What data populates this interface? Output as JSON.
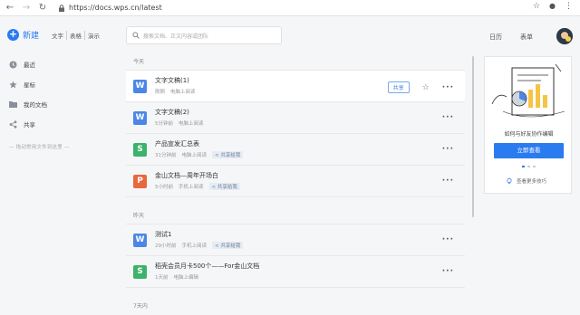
{
  "browser": {
    "url": "https://docs.wps.cn/latest"
  },
  "appbar": {
    "new_label": "新建",
    "new_types": [
      "文字",
      "表格",
      "演示"
    ],
    "search_placeholder": "搜索文档、正文内容或团队",
    "calendar": "日历",
    "forms": "表单"
  },
  "sidebar": {
    "items": [
      {
        "label": "最近",
        "icon": "clock-icon"
      },
      {
        "label": "星标",
        "icon": "star-icon"
      },
      {
        "label": "我的文档",
        "icon": "folder-icon"
      },
      {
        "label": "共享",
        "icon": "share-icon"
      }
    ],
    "hint": "拖动常用文件到这里"
  },
  "sections": [
    {
      "title": "今天",
      "files": [
        {
          "icon": "W",
          "color": "#4a87e6",
          "name": "文字文稿(1)",
          "time": "刚刚",
          "device": "电脑上阅读",
          "shared": ""
        },
        {
          "icon": "W",
          "color": "#4a87e6",
          "name": "文字文稿(2)",
          "time": "5分钟前",
          "device": "电脑上阅读",
          "shared": ""
        },
        {
          "icon": "S",
          "color": "#3bb36a",
          "name": "产品宣发汇总表",
          "time": "31分钟前",
          "device": "电脑上阅读",
          "shared": "共享给我"
        },
        {
          "icon": "P",
          "color": "#e8683e",
          "name": "金山文档—周年开场白",
          "time": "5小时前",
          "device": "手机上阅读",
          "shared": "共享给我"
        }
      ]
    },
    {
      "title": "昨天",
      "files": [
        {
          "icon": "W",
          "color": "#4a87e6",
          "name": "测试1",
          "time": "29小时前",
          "device": "手机上阅读",
          "shared": "共享给我"
        },
        {
          "icon": "S",
          "color": "#3bb36a",
          "name": "稻壳会员月卡500个——For金山文档",
          "time": "1天前",
          "device": "电脑上编辑",
          "shared": ""
        }
      ]
    },
    {
      "title": "7天内",
      "files": []
    }
  ],
  "row_actions": {
    "share": "共享",
    "more": "···"
  },
  "promo": {
    "title": "如何与好友协作编辑",
    "button": "立即查看",
    "tips": "查看更多技巧"
  }
}
